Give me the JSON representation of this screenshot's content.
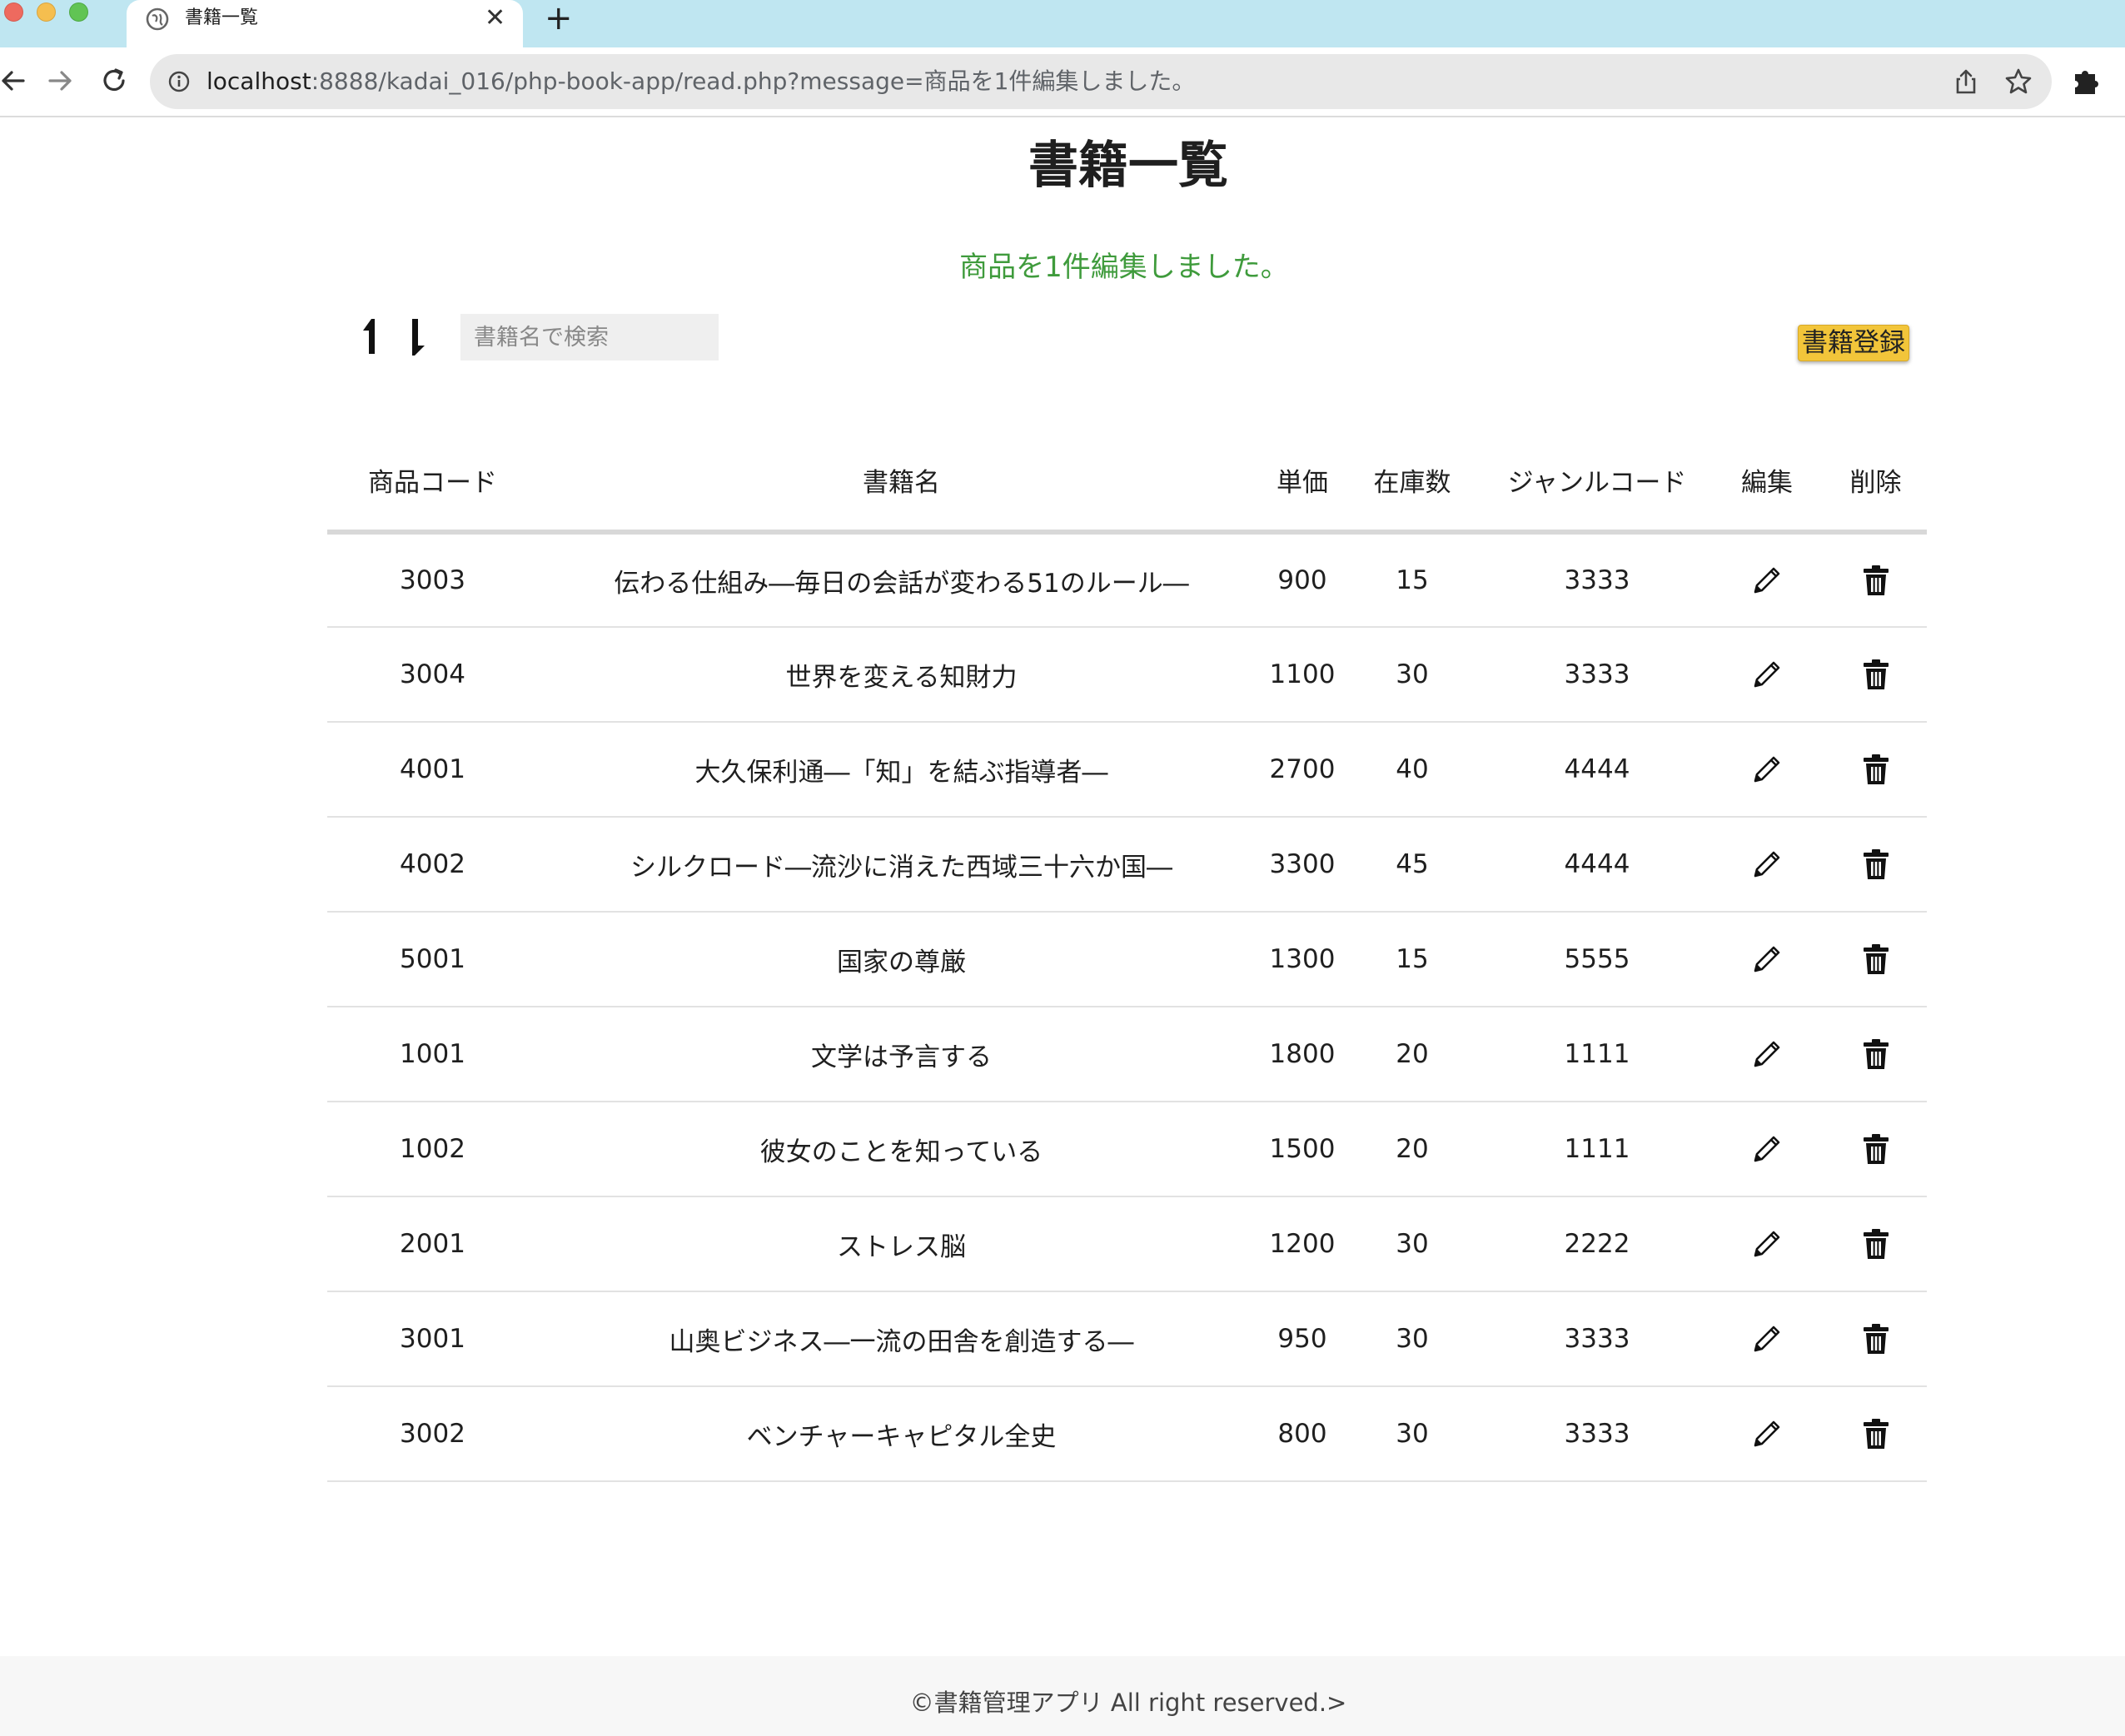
{
  "browser": {
    "tab": {
      "title": "書籍一覧",
      "close_label": "✕"
    },
    "new_tab_label": "+",
    "address": {
      "host": "localhost",
      "path": ":8888/kadai_016/php-book-app/read.php?message=商品を1件編集しました。"
    }
  },
  "page": {
    "title": "書籍一覧",
    "message": "商品を1件編集しました。",
    "search_placeholder": "書籍名で検索",
    "register_label": "書籍登録"
  },
  "table": {
    "headers": {
      "code": "商品コード",
      "name": "書籍名",
      "price": "単価",
      "stock": "在庫数",
      "genre": "ジャンルコード",
      "edit": "編集",
      "delete": "削除"
    },
    "rows": [
      {
        "code": "3003",
        "name": "伝わる仕組み―毎日の会話が変わる51のルール―",
        "price": "900",
        "stock": "15",
        "genre": "3333"
      },
      {
        "code": "3004",
        "name": "世界を変える知財力",
        "price": "1100",
        "stock": "30",
        "genre": "3333"
      },
      {
        "code": "4001",
        "name": "大久保利通―「知」を結ぶ指導者―",
        "price": "2700",
        "stock": "40",
        "genre": "4444"
      },
      {
        "code": "4002",
        "name": "シルクロード―流沙に消えた西域三十六か国―",
        "price": "3300",
        "stock": "45",
        "genre": "4444"
      },
      {
        "code": "5001",
        "name": "国家の尊厳",
        "price": "1300",
        "stock": "15",
        "genre": "5555"
      },
      {
        "code": "1001",
        "name": "文学は予言する",
        "price": "1800",
        "stock": "20",
        "genre": "1111"
      },
      {
        "code": "1002",
        "name": "彼女のことを知っている",
        "price": "1500",
        "stock": "20",
        "genre": "1111"
      },
      {
        "code": "2001",
        "name": "ストレス脳",
        "price": "1200",
        "stock": "30",
        "genre": "2222"
      },
      {
        "code": "3001",
        "name": "山奥ビジネス―一流の田舎を創造する―",
        "price": "950",
        "stock": "30",
        "genre": "3333"
      },
      {
        "code": "3002",
        "name": "ベンチャーキャピタル全史",
        "price": "800",
        "stock": "30",
        "genre": "3333"
      }
    ]
  },
  "footer": {
    "text": "©書籍管理アプリ All right reserved.>"
  },
  "icons": {
    "sort_asc": "arrow-up-icon",
    "sort_desc": "arrow-down-icon",
    "edit": "pencil-icon",
    "delete": "trash-icon"
  },
  "colors": {
    "tabbar": "#bfe6f1",
    "message": "#3f9b3c",
    "register_button": "#f2c53a"
  }
}
